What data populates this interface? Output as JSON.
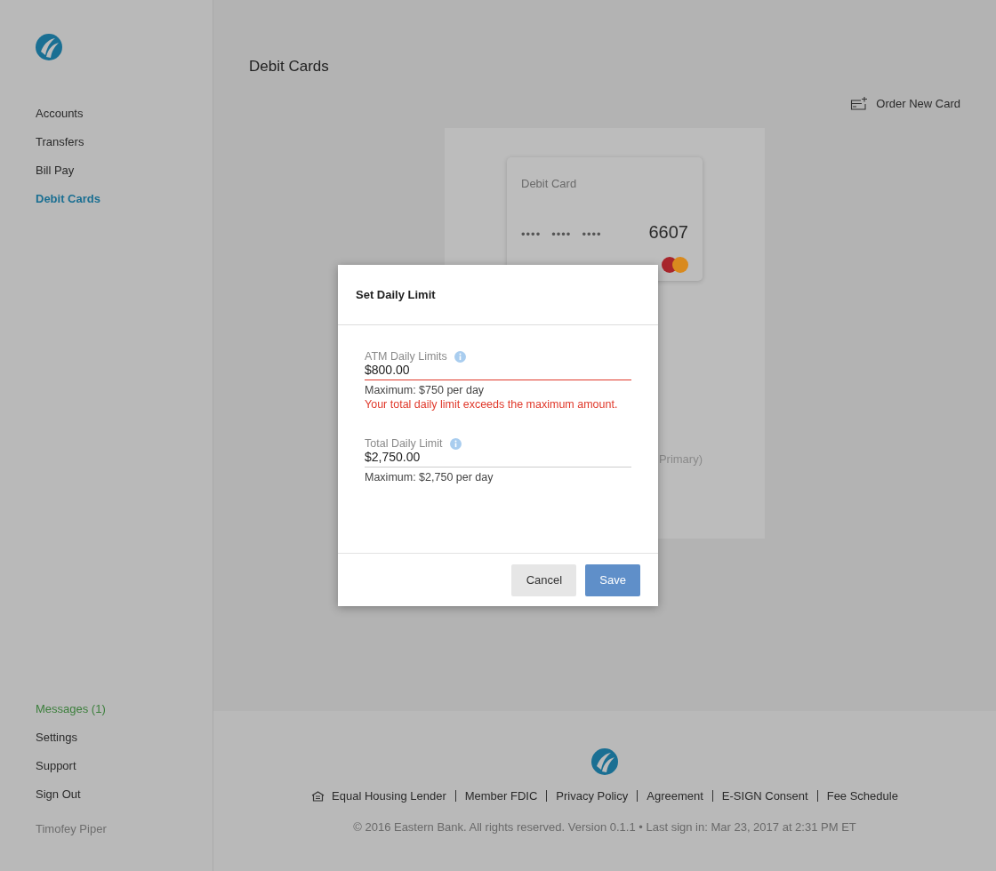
{
  "sidebar": {
    "nav": [
      {
        "label": "Accounts",
        "selected": false
      },
      {
        "label": "Transfers",
        "selected": false
      },
      {
        "label": "Bill Pay",
        "selected": false
      },
      {
        "label": "Debit Cards",
        "selected": true
      }
    ],
    "bottom": [
      {
        "label": "Messages (1)",
        "unread": true
      },
      {
        "label": "Settings",
        "unread": false
      },
      {
        "label": "Support",
        "unread": false
      },
      {
        "label": "Sign Out",
        "unread": false
      }
    ],
    "user": "Timofey Piper"
  },
  "page": {
    "title": "Debit Cards",
    "action": "Order New Card",
    "card": {
      "type": "Debit Card",
      "masked": [
        "••••",
        "••••",
        "••••"
      ],
      "last4": "6607"
    },
    "primary_note": "Primary)"
  },
  "dialog": {
    "title": "Set Daily Limit",
    "fields": [
      {
        "label": "ATM Daily Limits",
        "value": "$800.00",
        "hint": "Maximum: $750 per day",
        "error": "Your total daily limit exceeds the maximum amount.",
        "invalid": true
      },
      {
        "label": "Total Daily Limit",
        "value": "$2,750.00",
        "hint": "Maximum: $2,750 per day",
        "invalid": false
      }
    ],
    "buttons": [
      {
        "label": "Cancel",
        "kind": "secondary"
      },
      {
        "label": "Save",
        "kind": "primary"
      }
    ]
  },
  "footer": {
    "links": [
      "Equal Housing Lender",
      "Member FDIC",
      "Privacy Policy",
      "Agreement",
      "E-SIGN Consent",
      "Fee Schedule"
    ],
    "copyright": "© 2016 Eastern Bank. All rights reserved. Version 0.1.1 • Last sign in: Mar 23, 2017 at 2:31 PM ET"
  }
}
